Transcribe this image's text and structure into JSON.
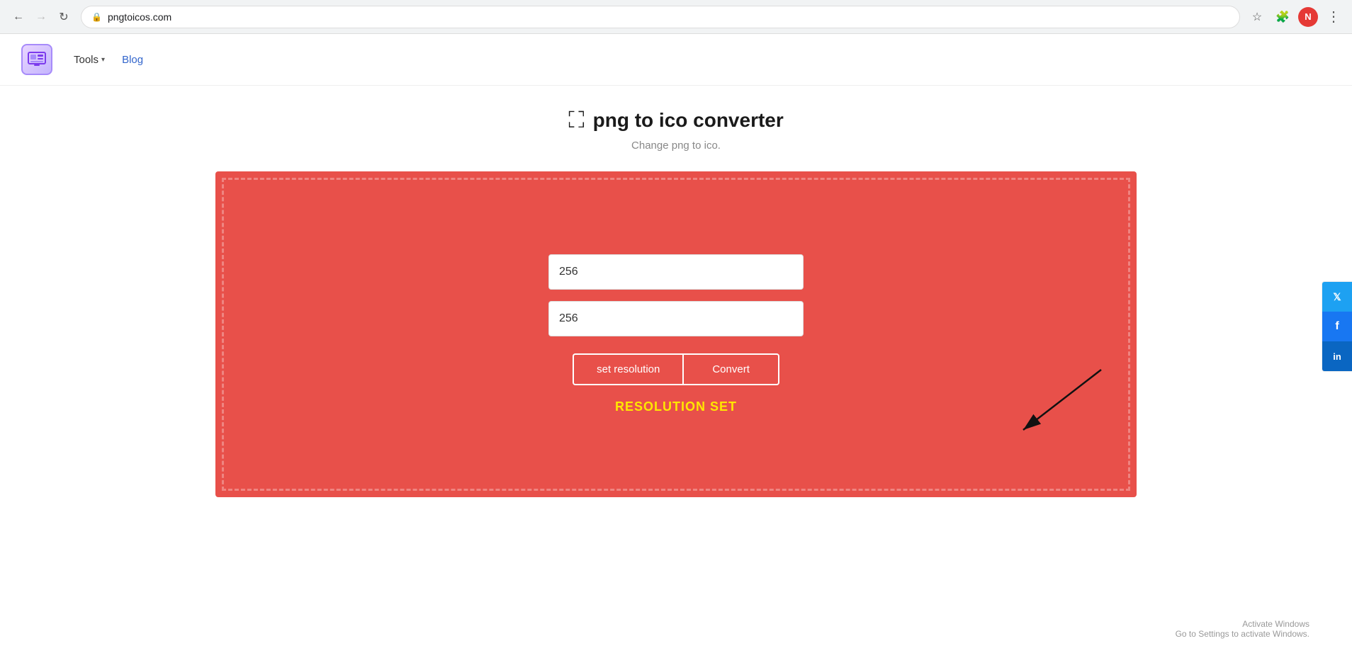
{
  "browser": {
    "url": "pngtoicos.com",
    "back_disabled": false,
    "forward_disabled": true,
    "user_initial": "N"
  },
  "navbar": {
    "tools_label": "Tools",
    "blog_label": "Blog"
  },
  "page": {
    "icon": "⛶",
    "title": "png to ico converter",
    "subtitle": "Change png to ico.",
    "input1_value": "256",
    "input2_value": "256",
    "btn_set_resolution": "set resolution",
    "btn_convert": "Convert",
    "resolution_set_text": "RESOLUTION SET"
  },
  "social": {
    "twitter": "𝕏",
    "facebook": "f",
    "linkedin": "in"
  },
  "windows": {
    "line1": "Activate Windows",
    "line2": "Go to Settings to activate Windows."
  }
}
